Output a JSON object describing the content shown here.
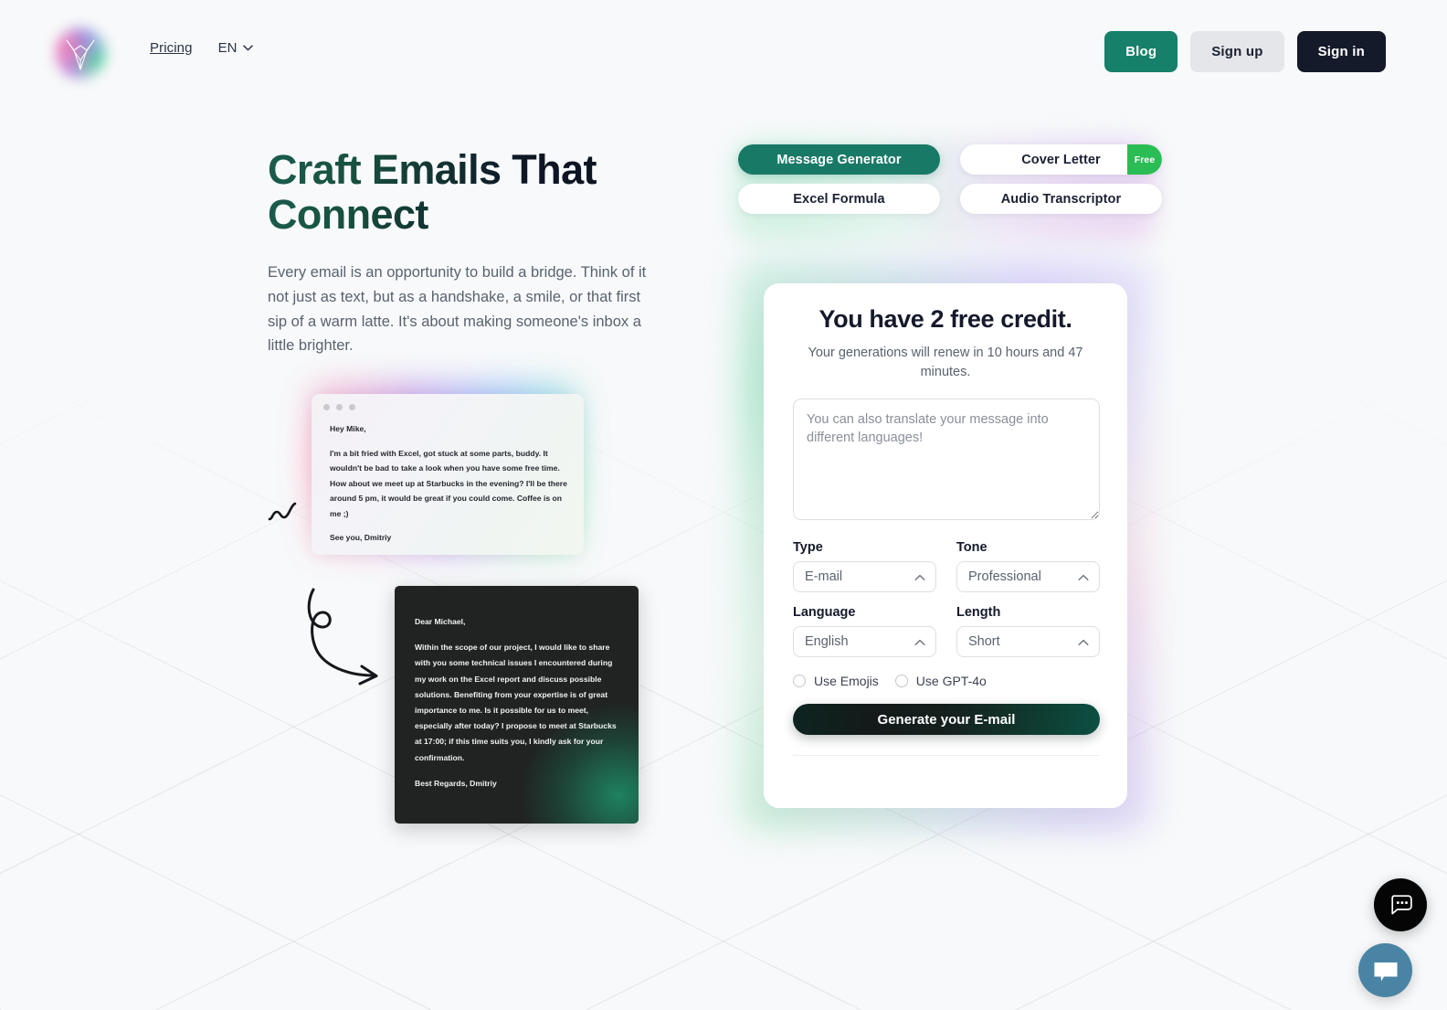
{
  "brand": {
    "logo_icon": "vector-logo-icon"
  },
  "header": {
    "nav": {
      "pricing": "Pricing",
      "language": "EN",
      "chevron_icon": "chevron-down-icon"
    },
    "buttons": {
      "blog": "Blog",
      "sign_up": "Sign up",
      "sign_in": "Sign in"
    },
    "colors": {
      "blog_bg": "#17806b",
      "signup_bg": "#e4e6e9",
      "signin_bg": "#151a2b"
    }
  },
  "hero": {
    "title": "Craft Emails That Connect",
    "paragraph": "Every email is an opportunity to build a bridge. Think of it not just as text, but as a handshake, a smile, or that first sip of a warm latte. It's about making someone's inbox a little brighter."
  },
  "mock_casual": {
    "greeting": "Hey Mike,",
    "body": "I'm a bit fried with Excel, got stuck at some parts, buddy. It wouldn't be bad to take a look when you have some free time. How about we meet up at Starbucks in the evening? I'll be there around 5 pm, it would be great if you could come. Coffee is on me ;)",
    "signoff": "See you, Dmitriy"
  },
  "mock_formal": {
    "greeting": "Dear Michael,",
    "body": "Within the scope of our project, I would like to share with you some technical issues I encountered during my work on the Excel report and discuss possible solutions. Benefiting from your expertise is of great importance to me. Is it possible for us to meet, especially after today? I propose to meet at Starbucks at 17:00; if this time suits you, I kindly ask for your confirmation.",
    "signoff": "Best Regards, Dmitriy"
  },
  "decorations": {
    "squiggle_icon": "squiggle-icon",
    "arrow_icon": "curved-arrow-icon"
  },
  "tabs": [
    {
      "label": "Message Generator",
      "active": true,
      "badge": null
    },
    {
      "label": "Cover Letter",
      "active": false,
      "badge": "Free"
    },
    {
      "label": "Excel Formula",
      "active": false,
      "badge": null
    },
    {
      "label": "Audio Transcriptor",
      "active": false,
      "badge": null
    }
  ],
  "tab_colors": {
    "active_bg": "#187a66",
    "badge_bg": "#2bbd55"
  },
  "generator": {
    "title": "You have 2 free credit.",
    "renew_text": "Your generations will renew in 10 hours and 47 minutes.",
    "message_placeholder": "You can also translate your message into different languages!",
    "message_value": "",
    "fields": [
      {
        "label": "Type",
        "value": "E-mail",
        "icon": "chevron-up-icon"
      },
      {
        "label": "Tone",
        "value": "Professional",
        "icon": "chevron-up-icon"
      },
      {
        "label": "Language",
        "value": "English",
        "icon": "chevron-up-icon"
      },
      {
        "label": "Length",
        "value": "Short",
        "icon": "chevron-up-icon"
      }
    ],
    "checkboxes": [
      {
        "label": "Use Emojis",
        "checked": false
      },
      {
        "label": "Use GPT-4o",
        "checked": false
      }
    ],
    "submit_label": "Generate your E-mail"
  },
  "widgets": {
    "chat_dark_icon": "chat-bubble-dots-icon",
    "chat_blue_icon": "chat-bubble-filled-icon",
    "chat_blue_color": "#4a84a4"
  }
}
